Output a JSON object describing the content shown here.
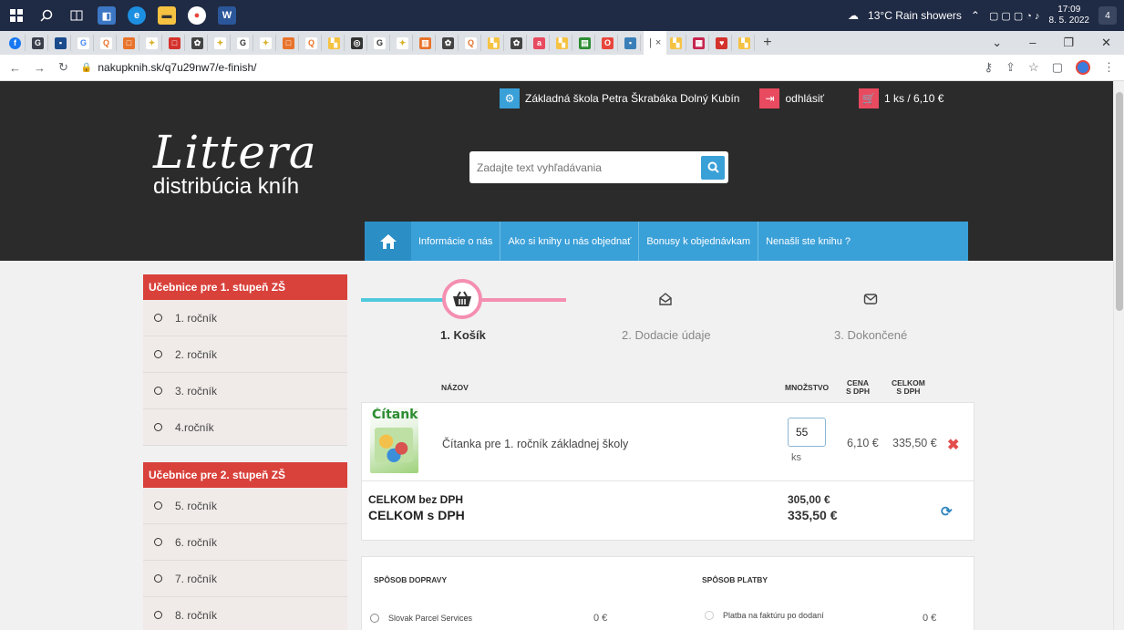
{
  "os": {
    "weather": "13°C  Rain showers",
    "time": "17:09",
    "date": "8. 5. 2022",
    "notifications": "4"
  },
  "browser": {
    "url": "nakupknih.sk/q7u29nw7/e-finish/"
  },
  "header": {
    "school_name": "Základná škola Petra Škrabáka Dolný Kubín",
    "logout_label": "odhlásiť",
    "cart_summary": "1 ks / 6,10 €",
    "logo_main": "Littera",
    "logo_sub": "distribúcia kníh",
    "search_placeholder": "Zadajte text vyhľadávania"
  },
  "nav": {
    "items": [
      "Informácie o nás",
      "Ako si knihy u nás objednať",
      "Bonusy k objednávkam",
      "Nenašli ste knihu ?"
    ]
  },
  "sidebar": {
    "groups": [
      {
        "title": "Učebnice pre 1. stupeň ZŠ",
        "items": [
          "1. ročník",
          "2. ročník",
          "3. ročník",
          "4.ročník"
        ]
      },
      {
        "title": "Učebnice pre 2. stupeň ZŠ",
        "items": [
          "5. ročník",
          "6. ročník",
          "7. ročník",
          "8. ročník"
        ]
      }
    ]
  },
  "steps": [
    {
      "label": "1. Košík",
      "active": true
    },
    {
      "label": "2. Dodacie údaje",
      "active": false
    },
    {
      "label": "3. Dokončené",
      "active": false
    }
  ],
  "cart": {
    "col_name": "NÁZOV",
    "col_qty": "MNOŽSTVO",
    "col_price_1": "CENA",
    "col_price_2": "S DPH",
    "col_total_1": "CELKOM",
    "col_total_2": "S DPH",
    "items": [
      {
        "book_title": "Čítanka",
        "name": "Čítanka pre 1. ročník základnej školy",
        "qty": "55",
        "unit": "ks",
        "price": "6,10 €",
        "total": "335,50 €"
      }
    ],
    "sum_no_vat_label": "CELKOM bez DPH",
    "sum_vat_label": "CELKOM s DPH",
    "sum_no_vat": "305,00 €",
    "sum_vat": "335,50 €"
  },
  "shipping": {
    "title": "SPÔSOB DOPRAVY",
    "option": "Slovak Parcel Services",
    "price": "0 €"
  },
  "payment": {
    "title": "SPÔSOB PLATBY",
    "option": "Platba na faktúru po dodaní",
    "price": "0 €"
  },
  "colors": {
    "accent_blue": "#3aa0d8",
    "accent_red": "#d9413b",
    "header_bg": "#2b2b2b"
  }
}
